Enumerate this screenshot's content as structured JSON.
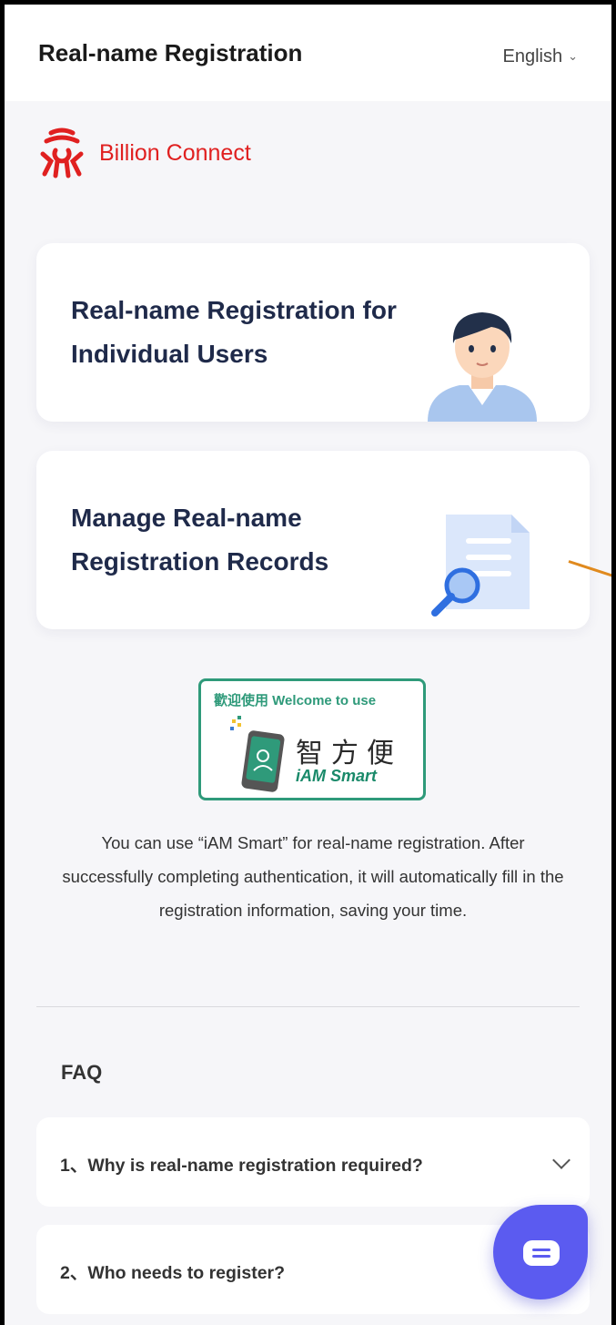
{
  "header": {
    "title": "Real-name Registration",
    "language": "English"
  },
  "brand": {
    "name": "Billion Connect",
    "color": "#e02020"
  },
  "cards": [
    {
      "label": "Real-name Registration for Individual Users",
      "icon": "user-avatar-illustration"
    },
    {
      "label": "Manage Real-name Registration Records",
      "icon": "document-search-illustration"
    }
  ],
  "iam_smart": {
    "welcome": "歡迎使用 Welcome to use",
    "chinese": "智方便",
    "english": "iAM Smart",
    "color": "#2f9a7a"
  },
  "description": "You can use “iAM Smart” for real-name registration. After successfully completing authentication, it will automatically fill in the registration information, saving your time.",
  "faq": {
    "title": "FAQ",
    "items": [
      {
        "question": "1、Why is real-name registration required?"
      },
      {
        "question": "2、Who needs to register?"
      }
    ]
  },
  "chat": {
    "icon": "chat-icon",
    "color": "#5b5bf0"
  }
}
